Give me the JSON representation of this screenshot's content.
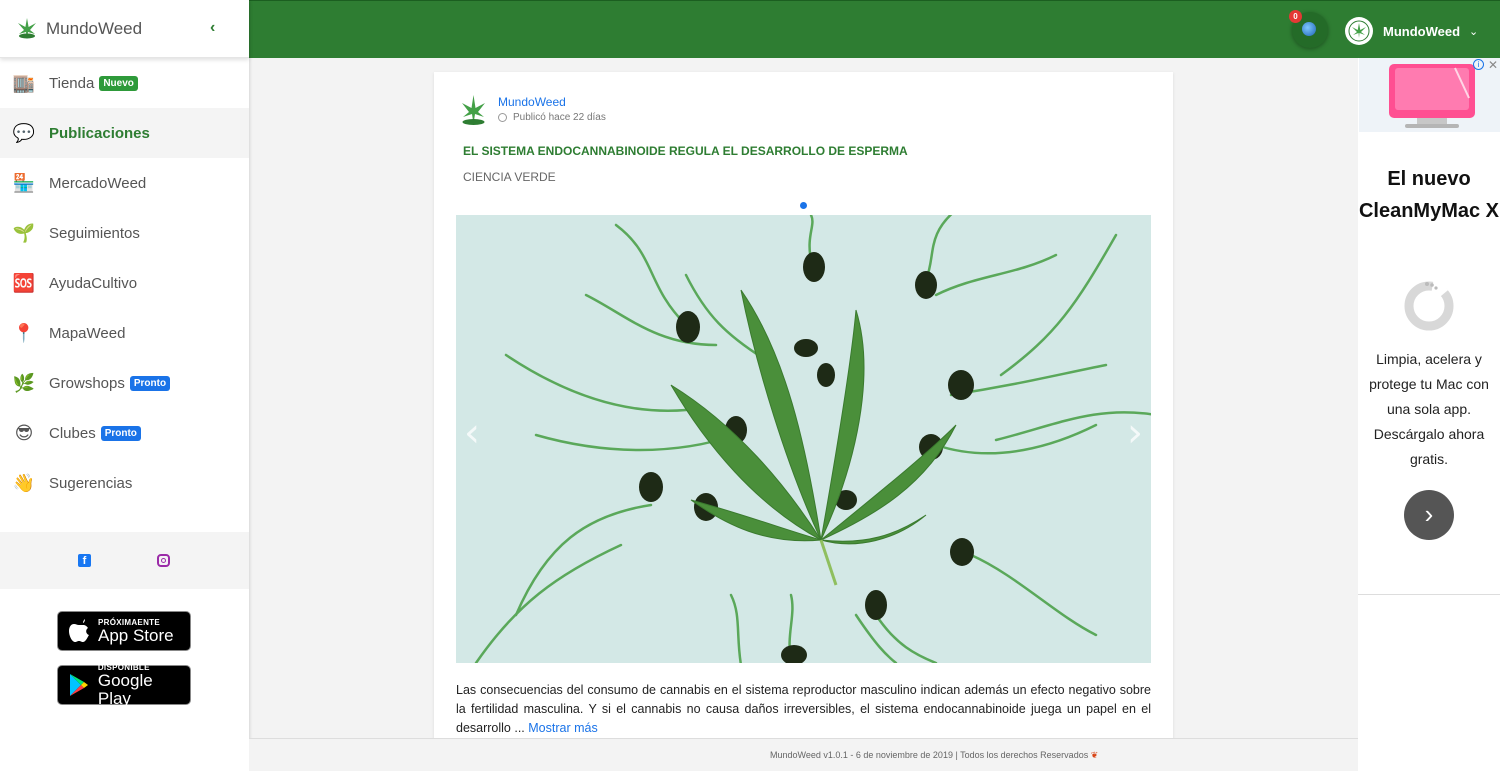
{
  "brand": {
    "name": "MundoWeed"
  },
  "topbar": {
    "notification_count": "0",
    "user_name": "MundoWeed"
  },
  "sidebar": {
    "items": [
      {
        "label": "Tienda",
        "icon": "store-icon",
        "glyph": "🏬",
        "badge": "Nuevo",
        "badge_color": "#2e9a3a"
      },
      {
        "label": "Publicaciones",
        "icon": "speech-bubble-icon",
        "glyph": "💬",
        "active": true
      },
      {
        "label": "MercadoWeed",
        "icon": "market-icon",
        "glyph": "🏪"
      },
      {
        "label": "Seguimientos",
        "icon": "seedling-icon",
        "glyph": "🌱"
      },
      {
        "label": "AyudaCultivo",
        "icon": "sos-icon",
        "glyph": "🆘"
      },
      {
        "label": "MapaWeed",
        "icon": "map-pin-icon",
        "glyph": "📍"
      },
      {
        "label": "Growshops",
        "icon": "herb-icon",
        "glyph": "🌿",
        "badge": "Pronto",
        "badge_color": "#1a73e8"
      },
      {
        "label": "Clubes",
        "icon": "sunglasses-icon",
        "glyph": "😎",
        "badge": "Pronto",
        "badge_color": "#1a73e8"
      },
      {
        "label": "Sugerencias",
        "icon": "waving-hand-icon",
        "glyph": "👋"
      }
    ],
    "app_store": {
      "small": "PRÓXIMAENTE",
      "big": "App Store"
    },
    "google_play": {
      "small": "DISPONIBLE",
      "big": "Google Play"
    }
  },
  "post": {
    "author": "MundoWeed",
    "time": "Publicó hace 22 días",
    "title": "EL SISTEMA ENDOCANNABINOIDE REGULA EL DESARROLLO DE ESPERMA",
    "category": "CIENCIA VERDE",
    "excerpt": "Las consecuencias del consumo de cannabis en el sistema reproductor masculino indican además un efecto negativo sobre la fertilidad masculina. Y si el cannabis no causa daños irreversibles, el sistema endocannabinoide juega un papel en el desarrollo ...",
    "more_label": "Mostrar más"
  },
  "footer": {
    "text": "MundoWeed v1.0.1 - 6 de noviembre de 2019   |   Todos los derechos Reservados"
  },
  "ad": {
    "headline": "El nuevo CleanMyMac X",
    "body": "Limpia, acelera y protege tu Mac con una sola app. Descárgalo ahora gratis."
  },
  "colors": {
    "primary_green": "#2e7d32",
    "link_blue": "#1a73e8"
  }
}
